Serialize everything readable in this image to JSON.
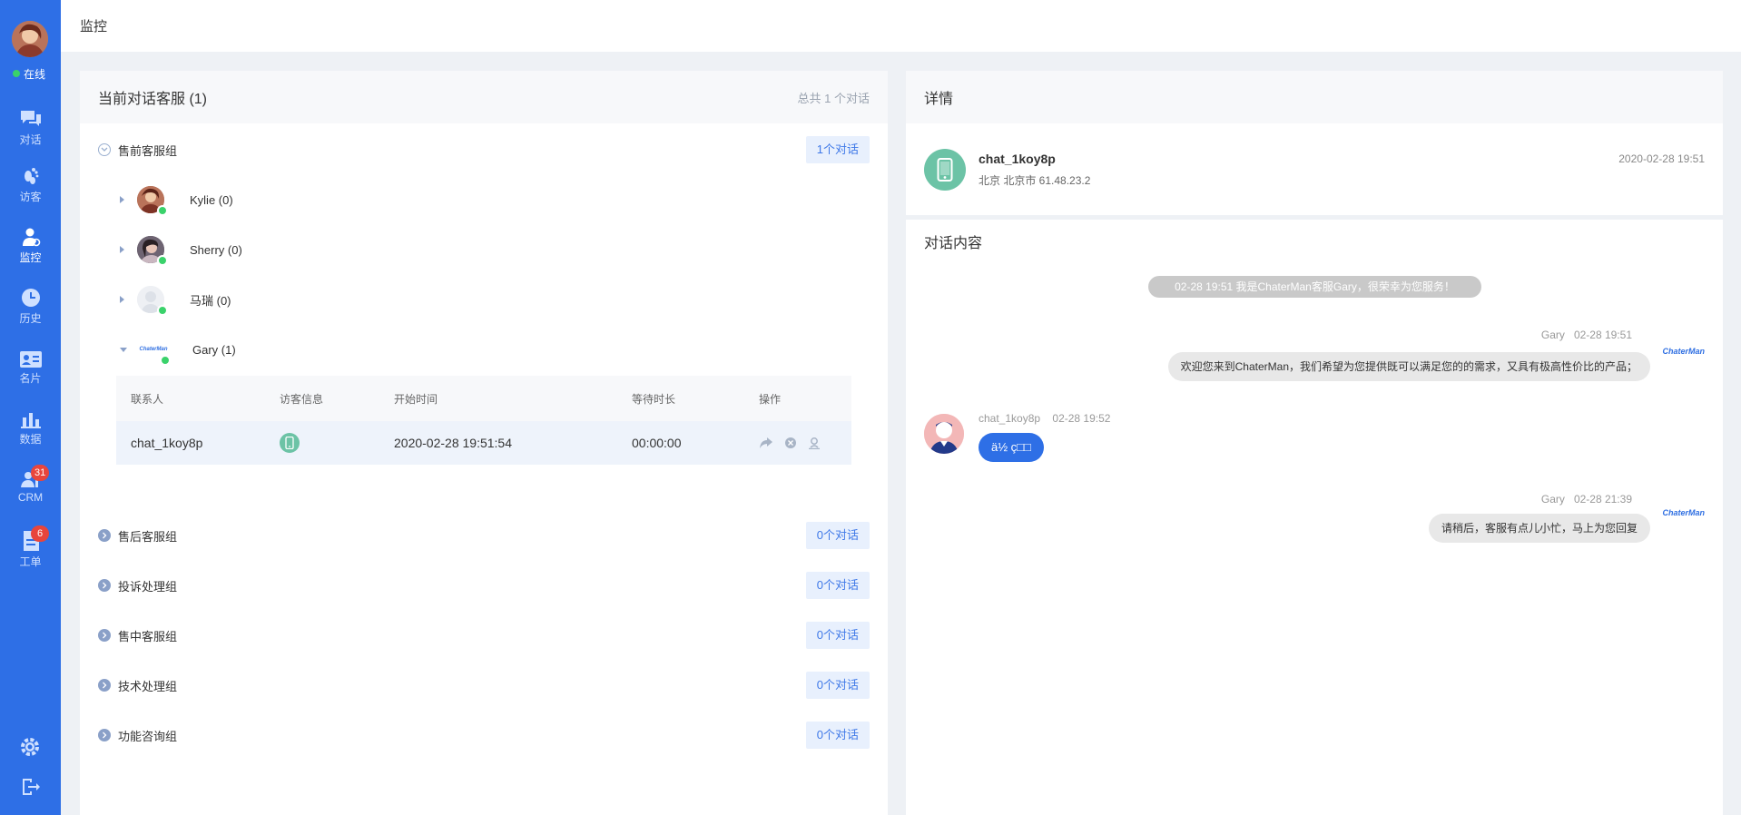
{
  "sidebar": {
    "status": "在线",
    "items": [
      {
        "label": "对话",
        "icon": "chat-icon"
      },
      {
        "label": "访客",
        "icon": "footprint-icon"
      },
      {
        "label": "监控",
        "icon": "monitor-icon",
        "active": true
      },
      {
        "label": "历史",
        "icon": "clock-icon"
      },
      {
        "label": "名片",
        "icon": "card-icon"
      },
      {
        "label": "数据",
        "icon": "bar-chart-icon"
      },
      {
        "label": "CRM",
        "icon": "crm-icon",
        "badge": "31"
      },
      {
        "label": "工单",
        "icon": "ticket-icon",
        "badge": "6"
      }
    ]
  },
  "header": {
    "title": "监控"
  },
  "left": {
    "title": "当前对话客服 (1)",
    "total": "总共 1 个对话",
    "groups": [
      {
        "name": "售前客服组",
        "count": "1个对话",
        "expanded": true
      },
      {
        "name": "售后客服组",
        "count": "0个对话"
      },
      {
        "name": "投诉处理组",
        "count": "0个对话"
      },
      {
        "name": "售中客服组",
        "count": "0个对话"
      },
      {
        "name": "技术处理组",
        "count": "0个对话"
      },
      {
        "name": "功能咨询组",
        "count": "0个对话"
      }
    ],
    "agents": [
      {
        "name": "Kylie (0)"
      },
      {
        "name": "Sherry (0)"
      },
      {
        "name": "马瑞 (0)"
      },
      {
        "name": "Gary (1)"
      }
    ],
    "table": {
      "headers": [
        "联系人",
        "访客信息",
        "开始时间",
        "等待时长",
        "操作"
      ],
      "row": {
        "contact": "chat_1koy8p",
        "start": "2020-02-28 19:51:54",
        "wait": "00:00:00"
      }
    }
  },
  "detail": {
    "title": "详情",
    "name": "chat_1koy8p",
    "location": "北京 北京市   61.48.23.2",
    "time": "2020-02-28 19:51"
  },
  "chat": {
    "title": "对话内容",
    "system": "02-28 19:51 我是ChaterMan客服Gary，很荣幸为您服务！",
    "logo": "ChaterMan",
    "messages": [
      {
        "sender": "Gary",
        "time": "02-28 19:51",
        "text": "欢迎您来到ChaterMan，我们希望为您提供既可以满足您的的需求，又具有极高性价比的产品；"
      },
      {
        "sender": "chat_1koy8p",
        "time": "02-28 19:52",
        "text": "ä½ ç□□"
      },
      {
        "sender": "Gary",
        "time": "02-28 21:39",
        "text": "请稍后，客服有点儿小忙，马上为您回复"
      }
    ]
  }
}
